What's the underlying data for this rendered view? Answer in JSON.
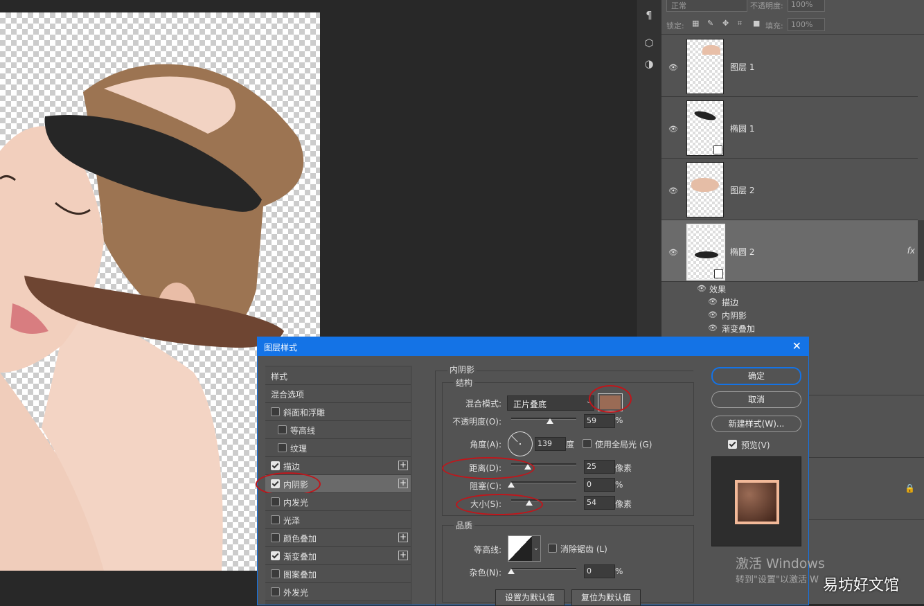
{
  "layers_panel": {
    "blend_mode": "正常",
    "opacity_label": "不透明度:",
    "opacity_value": "100%",
    "lock_label": "锁定:",
    "fill_label": "填充:",
    "fill_value": "100%",
    "layers": [
      {
        "name": "图层 1",
        "selected": false
      },
      {
        "name": "椭圆 1",
        "selected": false
      },
      {
        "name": "图层 2",
        "selected": false
      },
      {
        "name": "椭圆 2",
        "selected": true
      }
    ],
    "fx_badge": "fx",
    "effects_label": "效果",
    "effects": [
      "描边",
      "内阴影",
      "渐变叠加"
    ]
  },
  "dialog": {
    "title": "图层样式",
    "styles_header": "样式",
    "blend_options": "混合选项",
    "style_items": [
      {
        "label": "斜面和浮雕",
        "checked": false,
        "plus": false,
        "indent": false
      },
      {
        "label": "等高线",
        "checked": false,
        "plus": false,
        "indent": true
      },
      {
        "label": "纹理",
        "checked": false,
        "plus": false,
        "indent": true
      },
      {
        "label": "描边",
        "checked": true,
        "plus": true,
        "indent": false
      },
      {
        "label": "内阴影",
        "checked": true,
        "plus": true,
        "indent": false
      },
      {
        "label": "内发光",
        "checked": false,
        "plus": false,
        "indent": false
      },
      {
        "label": "光泽",
        "checked": false,
        "plus": false,
        "indent": false
      },
      {
        "label": "颜色叠加",
        "checked": false,
        "plus": true,
        "indent": false
      },
      {
        "label": "渐变叠加",
        "checked": true,
        "plus": true,
        "indent": false
      },
      {
        "label": "图案叠加",
        "checked": false,
        "plus": false,
        "indent": false
      },
      {
        "label": "外发光",
        "checked": false,
        "plus": false,
        "indent": false
      }
    ],
    "section_title": "内阴影",
    "structure_title": "结构",
    "blend_mode_label": "混合模式:",
    "blend_mode_value": "正片叠底",
    "shadow_color": "#9a6b55",
    "opacity_label": "不透明度(O):",
    "opacity_value": "59",
    "opacity_unit": "%",
    "angle_label": "角度(A):",
    "angle_value": "139",
    "angle_unit": "度",
    "global_light_label": "使用全局光 (G)",
    "distance_label": "距离(D):",
    "distance_value": "25",
    "distance_unit": "像素",
    "choke_label": "阻塞(C):",
    "choke_value": "0",
    "choke_unit": "%",
    "size_label": "大小(S):",
    "size_value": "54",
    "size_unit": "像素",
    "quality_title": "品质",
    "contour_label": "等高线:",
    "antialias_label": "消除锯齿 (L)",
    "noise_label": "杂色(N):",
    "noise_value": "0",
    "noise_unit": "%",
    "set_default": "设置为默认值",
    "reset_default": "复位为默认值",
    "ok": "确定",
    "cancel": "取消",
    "new_style": "新建样式(W)...",
    "preview_label": "预览(V)"
  },
  "watermark": {
    "activate_title": "激活 Windows",
    "activate_sub": "转到\"设置\"以激活 W",
    "site": "易坊好文馆"
  }
}
